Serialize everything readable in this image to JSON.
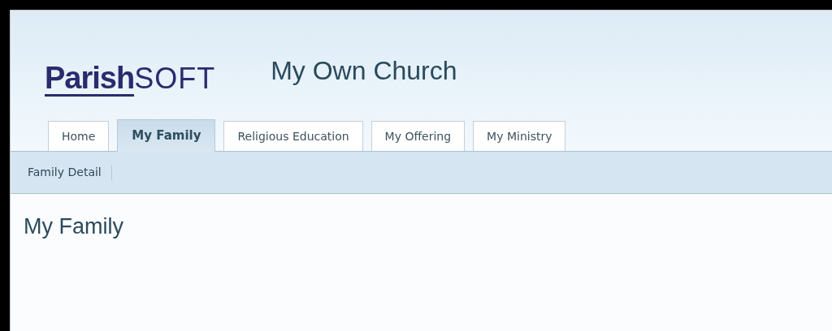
{
  "logo": {
    "part_1": "Parish",
    "part_2": "SOFT"
  },
  "site_title": "My Own Church",
  "tabs": [
    {
      "label": "Home",
      "selected": false
    },
    {
      "label": "My Family",
      "selected": true
    },
    {
      "label": "Religious Education",
      "selected": false
    },
    {
      "label": "My Offering",
      "selected": false
    },
    {
      "label": "My Ministry",
      "selected": false
    }
  ],
  "subnav": [
    "Family Detail"
  ],
  "page_heading": "My Family"
}
